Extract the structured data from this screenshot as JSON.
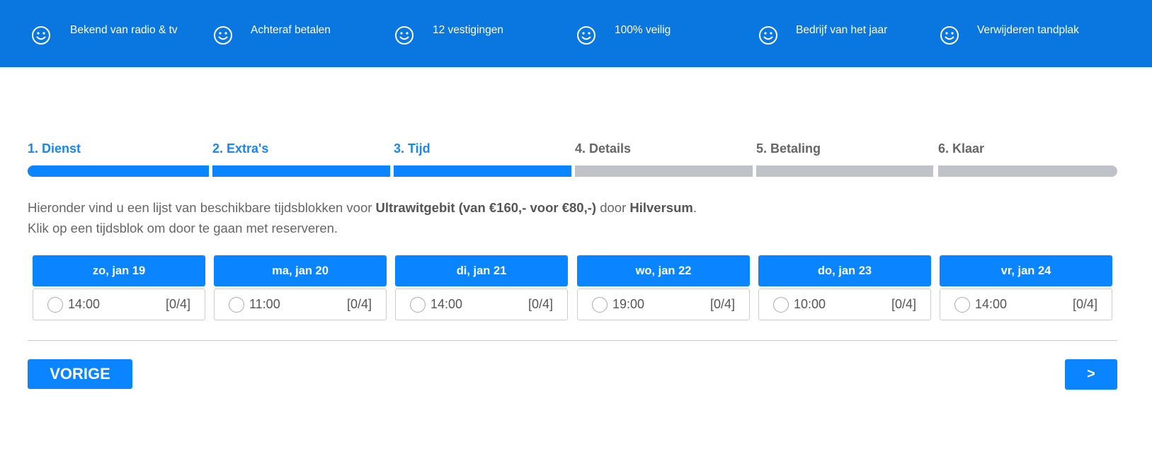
{
  "usps": [
    {
      "icon": "smiley-icon",
      "text": "Bekend van radio & tv"
    },
    {
      "icon": "smiley-icon",
      "text": "Achteraf betalen"
    },
    {
      "icon": "smiley-icon",
      "text": "12 vestigingen"
    },
    {
      "icon": "smiley-icon",
      "text": "100% veilig"
    },
    {
      "icon": "smiley-icon",
      "text": "Bedrijf van het jaar"
    },
    {
      "icon": "smiley-icon",
      "text": "Verwijderen tandplak"
    }
  ],
  "steps": [
    {
      "label": "1. Dienst",
      "state": "done"
    },
    {
      "label": "2. Extra's",
      "state": "done"
    },
    {
      "label": "3. Tijd",
      "state": "current"
    },
    {
      "label": "4. Details",
      "state": "todo"
    },
    {
      "label": "5. Betaling",
      "state": "todo"
    },
    {
      "label": "6. Klaar",
      "state": "todo"
    }
  ],
  "intro": {
    "prefix": "Hieronder vind u een lijst van beschikbare tijdsblokken voor ",
    "service": "Ultrawitgebit (van €160,- voor €80,-)",
    "middle": " door ",
    "location": "Hilversum",
    "suffix": ".",
    "line2": "Klik op een tijdsblok om door te gaan met reserveren."
  },
  "days": [
    {
      "date": "zo, jan 19",
      "time": "14:00",
      "capacity": "[0/4]"
    },
    {
      "date": "ma, jan 20",
      "time": "11:00",
      "capacity": "[0/4]"
    },
    {
      "date": "di, jan 21",
      "time": "14:00",
      "capacity": "[0/4]"
    },
    {
      "date": "wo, jan 22",
      "time": "19:00",
      "capacity": "[0/4]"
    },
    {
      "date": "do, jan 23",
      "time": "10:00",
      "capacity": "[0/4]"
    },
    {
      "date": "vr, jan 24",
      "time": "14:00",
      "capacity": "[0/4]"
    }
  ],
  "buttons": {
    "prev": "VORIGE",
    "next": ">"
  },
  "colors": {
    "topbar": "#0a77e0",
    "accent": "#0a84ff",
    "step_todo": "#bfc2c6"
  }
}
